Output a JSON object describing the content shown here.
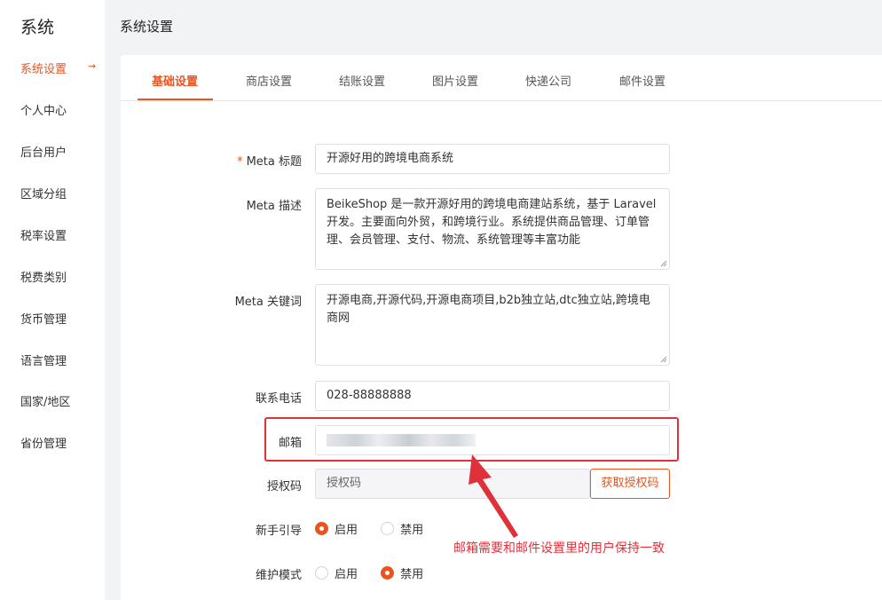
{
  "sidebar": {
    "title": "系统",
    "items": [
      {
        "label": "系统设置"
      },
      {
        "label": "个人中心"
      },
      {
        "label": "后台用户"
      },
      {
        "label": "区域分组"
      },
      {
        "label": "税率设置"
      },
      {
        "label": "税费类别"
      },
      {
        "label": "货币管理"
      },
      {
        "label": "语言管理"
      },
      {
        "label": "国家/地区"
      },
      {
        "label": "省份管理"
      }
    ],
    "active_arrow": "→"
  },
  "page": {
    "title": "系统设置"
  },
  "tabs": [
    {
      "label": "基础设置"
    },
    {
      "label": "商店设置"
    },
    {
      "label": "结账设置"
    },
    {
      "label": "图片设置"
    },
    {
      "label": "快递公司"
    },
    {
      "label": "邮件设置"
    }
  ],
  "form": {
    "meta_title": {
      "required_mark": "*",
      "label": "Meta 标题",
      "value": "开源好用的跨境电商系统"
    },
    "meta_description": {
      "label": "Meta 描述",
      "value": "BeikeShop 是一款开源好用的跨境电商建站系统，基于 Laravel 开发。主要面向外贸，和跨境行业。系统提供商品管理、订单管理、会员管理、支付、物流、系统管理等丰富功能"
    },
    "meta_keywords": {
      "label": "Meta 关键词",
      "value": "开源电商,开源代码,开源电商项目,b2b独立站,dtc独立站,跨境电商网"
    },
    "phone": {
      "label": "联系电话",
      "value": "028-88888888"
    },
    "email": {
      "label": "邮箱"
    },
    "license": {
      "label": "授权码",
      "placeholder": "授权码",
      "button": "获取授权码"
    },
    "guide": {
      "label": "新手引导",
      "options": [
        "启用",
        "禁用"
      ],
      "selected": "启用"
    },
    "maintenance": {
      "label": "维护模式",
      "options": [
        "启用",
        "禁用"
      ],
      "selected": "禁用"
    }
  },
  "annotation": {
    "note": "邮箱需要和邮件设置里的用户保持一致",
    "color": "#e0303a"
  },
  "colors": {
    "accent": "#e9541f"
  }
}
